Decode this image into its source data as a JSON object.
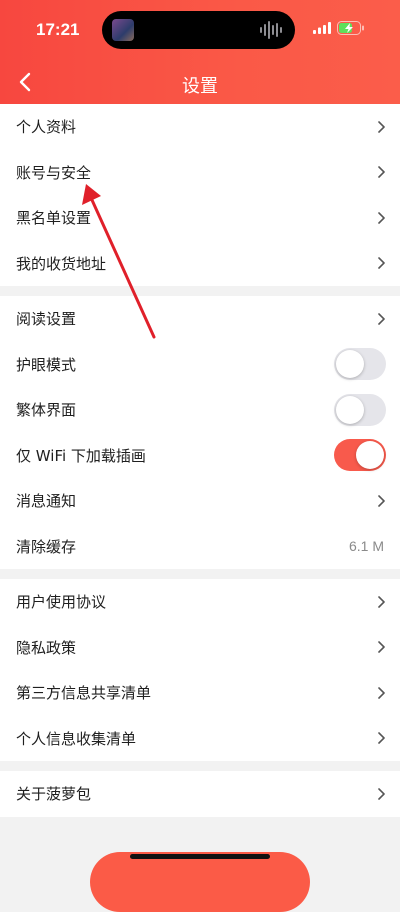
{
  "status_bar": {
    "time": "17:21"
  },
  "nav": {
    "title": "设置"
  },
  "groups": [
    {
      "rows": [
        {
          "label": "个人资料"
        },
        {
          "label": "账号与安全"
        },
        {
          "label": "黑名单设置"
        },
        {
          "label": "我的收货地址"
        }
      ]
    },
    {
      "rows": [
        {
          "label": "阅读设置"
        },
        {
          "label": "护眼模式",
          "toggle": false
        },
        {
          "label": "繁体界面",
          "toggle": false
        },
        {
          "label": "仅 WiFi 下加载插画",
          "toggle": true
        },
        {
          "label": "消息通知"
        },
        {
          "label": "清除缓存",
          "value": "6.1 M"
        }
      ]
    },
    {
      "rows": [
        {
          "label": "用户使用协议"
        },
        {
          "label": "隐私政策"
        },
        {
          "label": "第三方信息共享清单"
        },
        {
          "label": "个人信息收集清单"
        }
      ]
    },
    {
      "rows": [
        {
          "label": "关于菠萝包"
        }
      ]
    }
  ],
  "colors": {
    "accent": "#f7473f",
    "toggle_on": "#f85a4c",
    "arrow": "#e0202a"
  },
  "icons": [
    "back-arrow-icon",
    "chevron-right-icon",
    "signal-icon",
    "battery-charging-icon",
    "waveform-icon"
  ]
}
